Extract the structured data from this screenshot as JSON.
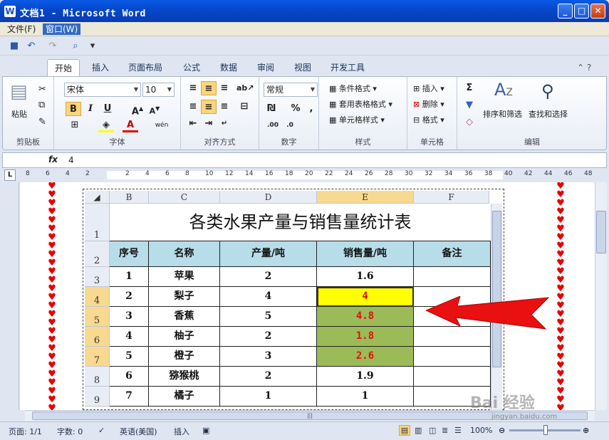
{
  "window": {
    "title": "文档1 - Microsoft Word",
    "app_icon": "W"
  },
  "menu": {
    "items": [
      "文件(F)",
      "窗口(W)"
    ]
  },
  "qat": {
    "icons": [
      "save-icon",
      "undo-icon",
      "redo-icon",
      "print-preview-icon",
      "customize-icon"
    ]
  },
  "tabs": {
    "items": [
      "开始",
      "插入",
      "页面布局",
      "公式",
      "数据",
      "审阅",
      "视图",
      "开发工具"
    ],
    "active": "开始"
  },
  "ribbon": {
    "clipboard": {
      "label": "剪贴板",
      "paste": "粘贴"
    },
    "font": {
      "label": "字体",
      "font_name": "宋体",
      "font_size": "10"
    },
    "alignment": {
      "label": "对齐方式"
    },
    "number": {
      "label": "数字",
      "format": "常规"
    },
    "styles": {
      "label": "样式",
      "cond_format": "条件格式",
      "table_format": "套用表格格式",
      "cell_style": "单元格样式"
    },
    "cells": {
      "label": "单元格",
      "insert": "插入",
      "delete": "删除",
      "format": "格式"
    },
    "editing": {
      "label": "编辑",
      "sort_filter": "排序和筛选",
      "find_select": "查找和选择"
    }
  },
  "formula_bar": {
    "fx": "fx",
    "value": "4"
  },
  "ruler": {
    "numbers": [
      "8",
      "6",
      "4",
      "2",
      "",
      "2",
      "4",
      "6",
      "8",
      "10",
      "12",
      "14",
      "16",
      "18",
      "20",
      "22",
      "24",
      "26",
      "28",
      "30",
      "32",
      "34",
      "36",
      "38",
      "40",
      "42",
      "44",
      "46",
      "48"
    ]
  },
  "spreadsheet": {
    "columns": [
      "B",
      "C",
      "D",
      "E",
      "F"
    ],
    "title": "各类水果产量与销售量统计表",
    "header_row": {
      "row_num": "2",
      "cells": [
        "序号",
        "名称",
        "产量/吨",
        "销售量/吨",
        "备注"
      ]
    },
    "rows": [
      {
        "row_num": "1"
      },
      {
        "row_num": "3",
        "cells": [
          "1",
          "苹果",
          "2",
          "1.6",
          ""
        ]
      },
      {
        "row_num": "4",
        "cells": [
          "2",
          "梨子",
          "4",
          "4",
          ""
        ]
      },
      {
        "row_num": "5",
        "cells": [
          "3",
          "香蕉",
          "5",
          "4.8",
          ""
        ]
      },
      {
        "row_num": "6",
        "cells": [
          "4",
          "柚子",
          "2",
          "1.8",
          ""
        ]
      },
      {
        "row_num": "7",
        "cells": [
          "5",
          "橙子",
          "3",
          "2.6",
          ""
        ]
      },
      {
        "row_num": "8",
        "cells": [
          "6",
          "猕猴桃",
          "2",
          "1.9",
          ""
        ]
      },
      {
        "row_num": "9",
        "cells": [
          "7",
          "橘子",
          "1",
          "1",
          ""
        ]
      }
    ],
    "colors": {
      "header_fill": "#b7dde8",
      "yellow": "#ffff00",
      "olive": "#9bbb59",
      "red_text": "#e01010"
    }
  },
  "status": {
    "page": "页面: 1/1",
    "words": "字数: 0",
    "language": "英语(美国)",
    "mode": "插入",
    "zoom": "100%"
  },
  "watermark": {
    "main": "Bai 经验",
    "url": "jingyan.baidu.com"
  }
}
